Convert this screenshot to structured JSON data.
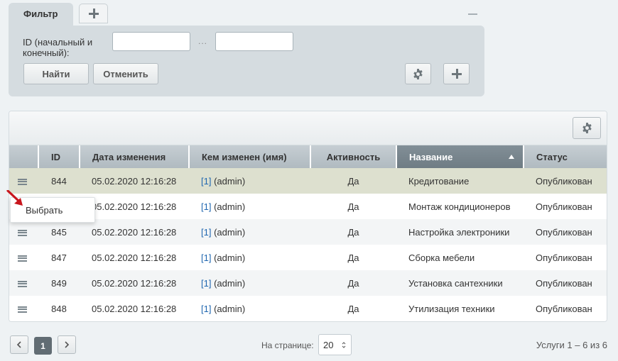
{
  "filter": {
    "tab_label": "Фильтр",
    "id_label": "ID (начальный и конечный):",
    "id_from_value": "",
    "id_to_value": "",
    "range_separator": "...",
    "find_button": "Найти",
    "cancel_button": "Отменить"
  },
  "table": {
    "columns": [
      "",
      "ID",
      "Дата изменения",
      "Кем изменен (имя)",
      "Активность",
      "Название",
      "Статус"
    ],
    "sorted_column": "Название",
    "rows": [
      {
        "id": "844",
        "date": "05.02.2020 12:16:28",
        "user_num": "[1]",
        "user_name": " (admin)",
        "active": "Да",
        "name": "Кредитование",
        "status": "Опубликован"
      },
      {
        "id": "",
        "date": "05.02.2020 12:16:28",
        "user_num": "[1]",
        "user_name": " (admin)",
        "active": "Да",
        "name": "Монтаж кондиционеров",
        "status": "Опубликован"
      },
      {
        "id": "845",
        "date": "05.02.2020 12:16:28",
        "user_num": "[1]",
        "user_name": " (admin)",
        "active": "Да",
        "name": "Настройка электроники",
        "status": "Опубликован"
      },
      {
        "id": "847",
        "date": "05.02.2020 12:16:28",
        "user_num": "[1]",
        "user_name": " (admin)",
        "active": "Да",
        "name": "Сборка мебели",
        "status": "Опубликован"
      },
      {
        "id": "849",
        "date": "05.02.2020 12:16:28",
        "user_num": "[1]",
        "user_name": " (admin)",
        "active": "Да",
        "name": "Установка сантехники",
        "status": "Опубликован"
      },
      {
        "id": "848",
        "date": "05.02.2020 12:16:28",
        "user_num": "[1]",
        "user_name": " (admin)",
        "active": "Да",
        "name": "Утилизация техники",
        "status": "Опубликован"
      }
    ]
  },
  "context_menu": {
    "select_label": "Выбрать"
  },
  "pager": {
    "current_page": "1",
    "per_page_label": "На странице:",
    "per_page_value": "20",
    "total_text": "Услуги 1 – 6 из 6"
  },
  "colors": {
    "selected_row": "#dde0cf",
    "sorted_header": "#7a8790",
    "link": "#2067b0",
    "arrow": "#c8161d"
  }
}
